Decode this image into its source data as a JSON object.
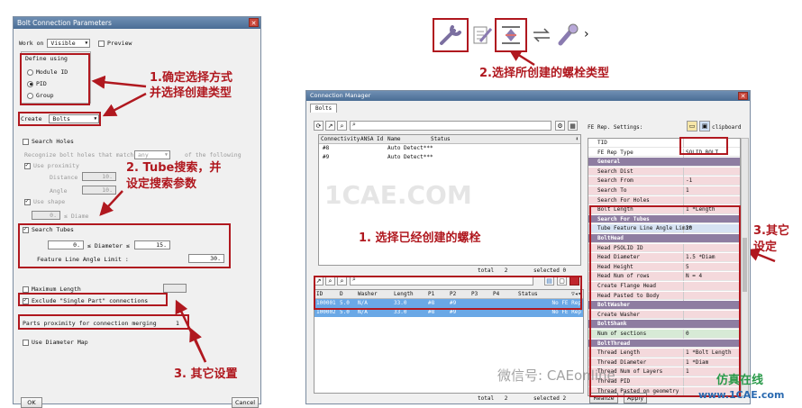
{
  "left_dialog": {
    "title": "Bolt Connection Parameters",
    "work_on_label": "Work on",
    "work_on_value": "Visible",
    "preview_label": "Preview",
    "define_using_label": "Define using",
    "radios": [
      "Module ID",
      "PID",
      "Group"
    ],
    "create_label": "Create",
    "create_value": "Bolts",
    "search_holes_label": "Search Holes",
    "recognize_text": "Recognize bolt holes that match",
    "any_value": "any",
    "of_following": "of the following",
    "use_proximity": "Use proximity",
    "distance_label": "Distance",
    "distance_value": "10.",
    "angle_label": "Angle",
    "angle_value": "10.",
    "use_shape": "Use shape",
    "shape_min": "0.",
    "shape_mid": "≤ Diame",
    "search_tubes_label": "Search Tubes",
    "tube_min": "0.",
    "tube_diam": "≤ Diameter ≤",
    "tube_max": "15.",
    "feature_line_label": "Feature Line Angle Limit :",
    "feature_line_value": "30.",
    "maximum_length": "Maximum Length",
    "exclude_single": "Exclude \"Single Part\" connections",
    "parts_proximity": "Parts proximity for connection merging",
    "parts_proximity_value": "1",
    "use_diameter_map": "Use Diameter Map",
    "ok_label": "OK",
    "cancel_label": "Cancel"
  },
  "annotations": {
    "a1_line1": "1.确定选择方式",
    "a1_line2": "并选择创建类型",
    "a2_line1": "2. Tube搜索，并",
    "a2_line2": "设定搜索参数",
    "a3": "3. 其它设置",
    "a_top": "2.选择所创建的螺栓类型",
    "a_mid": "1. 选择已经创建的螺栓",
    "a_right1": "3.其它",
    "a_right2": "设定"
  },
  "connection_manager": {
    "title": "Connection Manager",
    "tab": "Bolts",
    "top_columns": [
      "Connectivity",
      "ANSA Id",
      "Name",
      "Status"
    ],
    "top_rows": [
      [
        "#8",
        "",
        "Auto Detect***",
        ""
      ],
      [
        "#9",
        "",
        "Auto Detect***",
        ""
      ]
    ],
    "top_total": "total",
    "top_total_value": "2",
    "top_selected": "selected",
    "top_selected_value": "0",
    "bottom_columns": [
      "ID",
      "D",
      "Washer",
      "Length",
      "P1",
      "P2",
      "P3",
      "P4",
      "Status"
    ],
    "bottom_rows": [
      [
        "100001",
        "5.0",
        "N/A",
        "33.0",
        "#8",
        "#9",
        "",
        "",
        "",
        "No FE Rep"
      ],
      [
        "100002",
        "5.0",
        "N/A",
        "33.0",
        "#8",
        "#9",
        "",
        "",
        "",
        "No FE Rep"
      ]
    ],
    "bottom_total": "total",
    "bottom_total_value": "2",
    "bottom_selected": "selected",
    "bottom_selected_value": "2",
    "fe_rep_settings": "FE Rep. Settings:",
    "clipboard": "clipboard",
    "realize_label": "Realize",
    "apply_label": "Apply",
    "props": [
      {
        "k": "TID",
        "v": "",
        "c": "plain"
      },
      {
        "k": "FE Rep Type",
        "v": "SOLID BOLT",
        "c": "plain"
      },
      {
        "k": "General",
        "v": "",
        "c": "hdr"
      },
      {
        "k": "Search Dist",
        "v": "",
        "c": "pink"
      },
      {
        "k": "Search From",
        "v": "-1",
        "c": "pink"
      },
      {
        "k": "Search To",
        "v": "1",
        "c": "pink"
      },
      {
        "k": "Search For Holes",
        "v": "",
        "c": "pink"
      },
      {
        "k": "Bolt Length",
        "v": "1 *Length",
        "c": "pink"
      },
      {
        "k": "Search For Tubes",
        "v": "",
        "c": "hdr"
      },
      {
        "k": "Tube Feature Line Angle Limit",
        "v": "30",
        "c": "blue"
      },
      {
        "k": "BoltHead",
        "v": "",
        "c": "hdr"
      },
      {
        "k": "Head PSOLID ID",
        "v": "",
        "c": "pink"
      },
      {
        "k": "Head Diameter",
        "v": "1.5 *Diam",
        "c": "pink"
      },
      {
        "k": "Head Height",
        "v": "5",
        "c": "pink"
      },
      {
        "k": "Head Num of rows",
        "v": "N = 4",
        "c": "pink"
      },
      {
        "k": "Create Flange Head",
        "v": "",
        "c": "pink"
      },
      {
        "k": "Head Pasted to Body",
        "v": "",
        "c": "pink"
      },
      {
        "k": "BoltWasher",
        "v": "",
        "c": "hdr"
      },
      {
        "k": "Create Washer",
        "v": "",
        "c": "pink"
      },
      {
        "k": "BoltShank",
        "v": "",
        "c": "hdr"
      },
      {
        "k": "Num of sections",
        "v": "0",
        "c": "green"
      },
      {
        "k": "BoltThread",
        "v": "",
        "c": "hdr"
      },
      {
        "k": "Thread Length",
        "v": "1 *Bolt Length",
        "c": "pink"
      },
      {
        "k": "Thread Diameter",
        "v": "1 *Diam",
        "c": "pink"
      },
      {
        "k": "Thread Num of Layers",
        "v": "1",
        "c": "pink"
      },
      {
        "k": "Thread PID",
        "v": "",
        "c": "pink"
      },
      {
        "k": "Thread Pasted on geometry",
        "v": "",
        "c": "pink"
      }
    ]
  },
  "watermark": {
    "cae": "1CAE.COM",
    "wechat": "微信号: CAEonline",
    "brand": "仿真在线",
    "site": "www.1CAE.com"
  },
  "colors": {
    "red": "#b0181f",
    "selected_row": "#6aa8e6",
    "header_purple": "#8e7da1"
  }
}
